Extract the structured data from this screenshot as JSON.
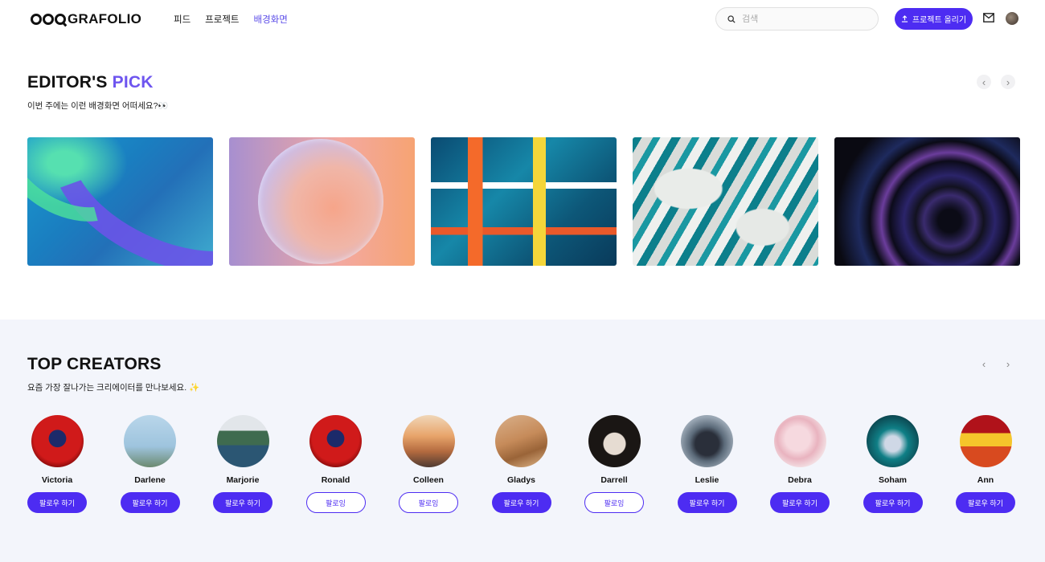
{
  "header": {
    "logo_text": "GRAFOLIO",
    "nav": [
      "피드",
      "프로젝트",
      "배경화면"
    ],
    "nav_active_index": 2,
    "search_placeholder": "검색",
    "upload_label": "프로젝트 올리기"
  },
  "editors_pick": {
    "title_main": "EDITOR'S",
    "title_accent": "PICK",
    "subtitle": "이번 주에는 이런 배경화면 어떠세요?👀",
    "cards": [
      {
        "icon": "wave-ribbon-artwork"
      },
      {
        "icon": "gradient-sphere-artwork"
      },
      {
        "icon": "abstract-paint-artwork"
      },
      {
        "icon": "teal-marble-artwork"
      },
      {
        "icon": "dark-swirl-artwork"
      }
    ]
  },
  "top_creators": {
    "title": "TOP CREATORS",
    "subtitle": "요즘 가장 잘나가는 크리에이터를 만나보세요. ✨",
    "creators": [
      {
        "name": "Victoria",
        "button": "팔로우 하기",
        "following": false
      },
      {
        "name": "Darlene",
        "button": "팔로우 하기",
        "following": false
      },
      {
        "name": "Marjorie",
        "button": "팔로우 하기",
        "following": false
      },
      {
        "name": "Ronald",
        "button": "팔로잉",
        "following": true
      },
      {
        "name": "Colleen",
        "button": "팔로잉",
        "following": true
      },
      {
        "name": "Gladys",
        "button": "팔로우 하기",
        "following": false
      },
      {
        "name": "Darrell",
        "button": "팔로잉",
        "following": true
      },
      {
        "name": "Leslie",
        "button": "팔로우 하기",
        "following": false
      },
      {
        "name": "Debra",
        "button": "팔로우 하기",
        "following": false
      },
      {
        "name": "Soham",
        "button": "팔로우 하기",
        "following": false
      },
      {
        "name": "Ann",
        "button": "팔로우 하기",
        "following": false
      }
    ]
  },
  "colors": {
    "accent": "#4d2cf2",
    "accent_text": "#6e55ef",
    "creators_bg": "#f3f5fb"
  }
}
